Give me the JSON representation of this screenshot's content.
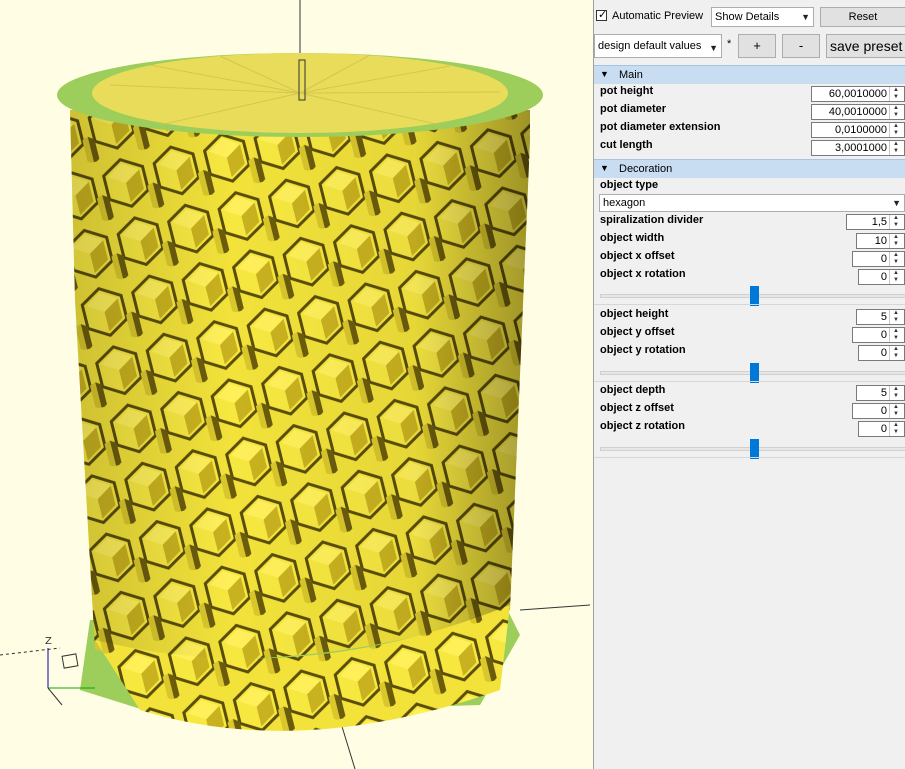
{
  "toolbar": {
    "auto_preview_label": "Automatic Preview",
    "auto_preview_checked": "✓",
    "details_value": "Show Details",
    "reset_label": "Reset"
  },
  "presets": {
    "value": "design default values",
    "modified_marker": "*",
    "add_label": "+",
    "remove_label": "-",
    "save_label": "save preset"
  },
  "main": {
    "title": "Main",
    "params": [
      {
        "label": "pot height",
        "value": "60,0010000"
      },
      {
        "label": "pot diameter",
        "value": "40,0010000"
      },
      {
        "label": "pot diameter extension",
        "value": "0,0100000"
      },
      {
        "label": "cut length",
        "value": "3,0001000"
      }
    ]
  },
  "decoration": {
    "title": "Decoration",
    "object_type_label": "object type",
    "object_type_value": "hexagon",
    "spiral_label": "spiralization divider",
    "spiral_value": "1,5",
    "width_label": "object width",
    "width_value": "10",
    "x_offset_label": "object x offset",
    "x_offset_value": "0",
    "x_rotation_label": "object x rotation",
    "x_rotation_value": "0",
    "height_label": "object height",
    "height_value": "5",
    "y_offset_label": "object y offset",
    "y_offset_value": "0",
    "y_rotation_label": "object y rotation",
    "y_rotation_value": "0",
    "depth_label": "object depth",
    "depth_value": "5",
    "z_offset_label": "object z offset",
    "z_offset_value": "0",
    "z_rotation_label": "object z rotation",
    "z_rotation_value": "0",
    "x_rotation_slider_fraction": 0.5,
    "y_rotation_slider_fraction": 0.5,
    "z_rotation_slider_fraction": 0.5
  },
  "viewport": {
    "axis_label": "Z",
    "background": "#fffee5",
    "model_color": "#f2e23a",
    "model_shadow": "#b8a41e",
    "top_color": "#e8dc5a",
    "top_edge_color": "#9dcd5a"
  }
}
